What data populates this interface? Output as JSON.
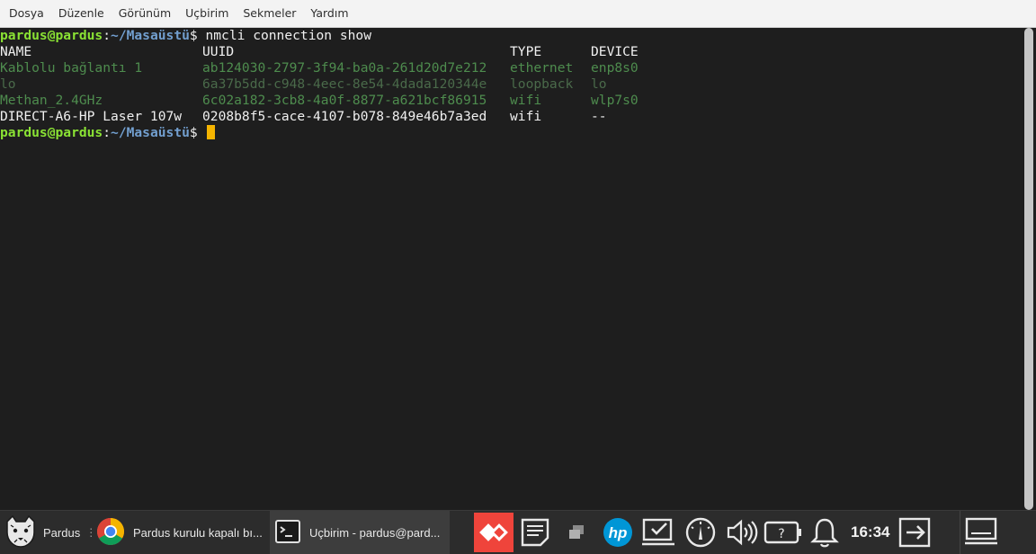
{
  "menubar": {
    "items": [
      "Dosya",
      "Düzenle",
      "Görünüm",
      "Uçbirim",
      "Sekmeler",
      "Yardım"
    ]
  },
  "terminal": {
    "prompt_user": "pardus@pardus",
    "prompt_path": "~/Masaüstü",
    "command": "nmcli connection show",
    "headers": {
      "name": "NAME",
      "uuid": "UUID",
      "type": "TYPE",
      "device": "DEVICE"
    },
    "rows": [
      {
        "name": "Kablolu bağlantı 1",
        "uuid": "ab124030-2797-3f94-ba0a-261d20d7e212",
        "type": "ethernet",
        "device": "enp8s0",
        "style": "green"
      },
      {
        "name": "lo",
        "uuid": "6a37b5dd-c948-4eec-8e54-4dada120344e",
        "type": "loopback",
        "device": "lo",
        "style": "gray"
      },
      {
        "name": "Methan_2.4GHz",
        "uuid": "6c02a182-3cb8-4a0f-8877-a621bcf86915",
        "type": "wifi",
        "device": "wlp7s0",
        "style": "green"
      },
      {
        "name": "DIRECT-A6-HP Laser 107w",
        "uuid": "0208b8f5-cace-4107-b078-849e46b7a3ed",
        "type": "wifi",
        "device": "--",
        "style": "white"
      }
    ],
    "colors": {
      "prompt_user": "#8ae234",
      "prompt_path": "#729fcf",
      "cursor": "#f5b400",
      "background": "#1e1e1e"
    }
  },
  "taskbar": {
    "start_label": "Pardus",
    "tasks": [
      {
        "label": "Pardus kurulu kapalı bı...",
        "icon": "chrome-icon"
      },
      {
        "label": "Uçbirim - pardus@pard...",
        "icon": "terminal-icon"
      }
    ],
    "clock": "16:34",
    "tray_icons": [
      "anydesk-icon",
      "notes-icon",
      "window-switch-icon",
      "hp-icon",
      "screenshot-icon",
      "gauge-icon",
      "volume-icon",
      "battery-help-icon",
      "notification-bell-icon",
      "logout-icon"
    ]
  }
}
